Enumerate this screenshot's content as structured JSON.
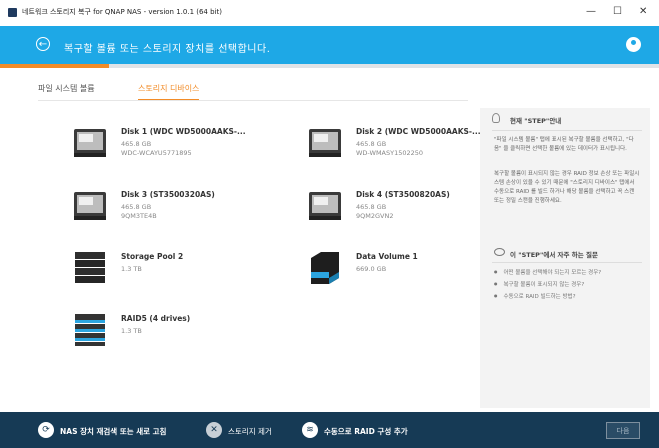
{
  "window": {
    "title": "네트워크 스토리지 복구 for QNAP NAS - version 1.0.1 (64 bit)",
    "minimize": "—",
    "maximize": "☐",
    "close": "✕"
  },
  "header": {
    "title": "복구할 볼륨 또는 스토리지 장치를 선택합니다."
  },
  "progress": {
    "fraction": 0.165
  },
  "tabs": [
    {
      "label": "파일 시스템 볼륨",
      "active": false
    },
    {
      "label": "스토리지 디바이스",
      "active": true
    }
  ],
  "devices": [
    {
      "name": "Disk 1 (WDC WD5000AAKS-...",
      "size": "465.8 GB",
      "serial": "WDC-WCAYU5771895",
      "icon": "hard-drive-icon"
    },
    {
      "name": "Disk 2 (WDC WD5000AAKS-...",
      "size": "465.8 GB",
      "serial": "WD-WMASY1502250",
      "icon": "hard-drive-icon"
    },
    {
      "name": "Disk 3 (ST3500320AS)",
      "size": "465.8 GB",
      "serial": "9QM3TE4B",
      "icon": "hard-drive-icon"
    },
    {
      "name": "Disk 4 (ST3500820AS)",
      "size": "465.8 GB",
      "serial": "9QM2GVN2",
      "icon": "hard-drive-icon"
    },
    {
      "name": "Storage Pool 2",
      "size": "1.3 TB",
      "serial": "",
      "icon": "storage-pool-icon"
    },
    {
      "name": "Data Volume 1",
      "size": "669.0 GB",
      "serial": "",
      "icon": "data-volume-icon"
    },
    {
      "name": "RAID5 (4 drives)",
      "size": "1.3 TB",
      "serial": "",
      "icon": "raid-icon"
    }
  ],
  "sidebar": {
    "current_step_title": "현재 \"STEP\"안내",
    "paragraph1": "\"파일 시스템 볼륨\" 탭에 표시된 복구할 볼륨을 선택하고, \"다음\" 을 클릭하면 선택한 볼륨에 있는 데이터가 표시됩니다.",
    "paragraph2": "복구할 볼륨이 표시되지 않는 경우 RAID 정보 손상 또는 파일시스템 손상이 있을 수 있기 때문에 \"스토리지 디바이스\" 탭에서 수동으로 RAID 를 빌드 하거나 해당 볼륨을 선택하고 꼭 스캔 또는 정밀 스캔을 진행하세요.",
    "faq_title": "이 \"STEP\"에서 자주 하는 질문",
    "faq": [
      "어떤 볼륨을 선택해야 되는지 모르는 경우?",
      "복구할 볼륨이 표시되지 않는 경우?",
      "수동으로 RAID 빌드하는 방법?"
    ]
  },
  "footer": {
    "rescan_label": "NAS 장치 재검색 또는 새로 고침",
    "remove_label": "스토리지 제거",
    "raid_label": "수동으로 RAID 구성 추가",
    "next_label": "다음"
  },
  "colors": {
    "header": "#1ea8e6",
    "accent": "#f28c28",
    "footer": "#163a55"
  }
}
